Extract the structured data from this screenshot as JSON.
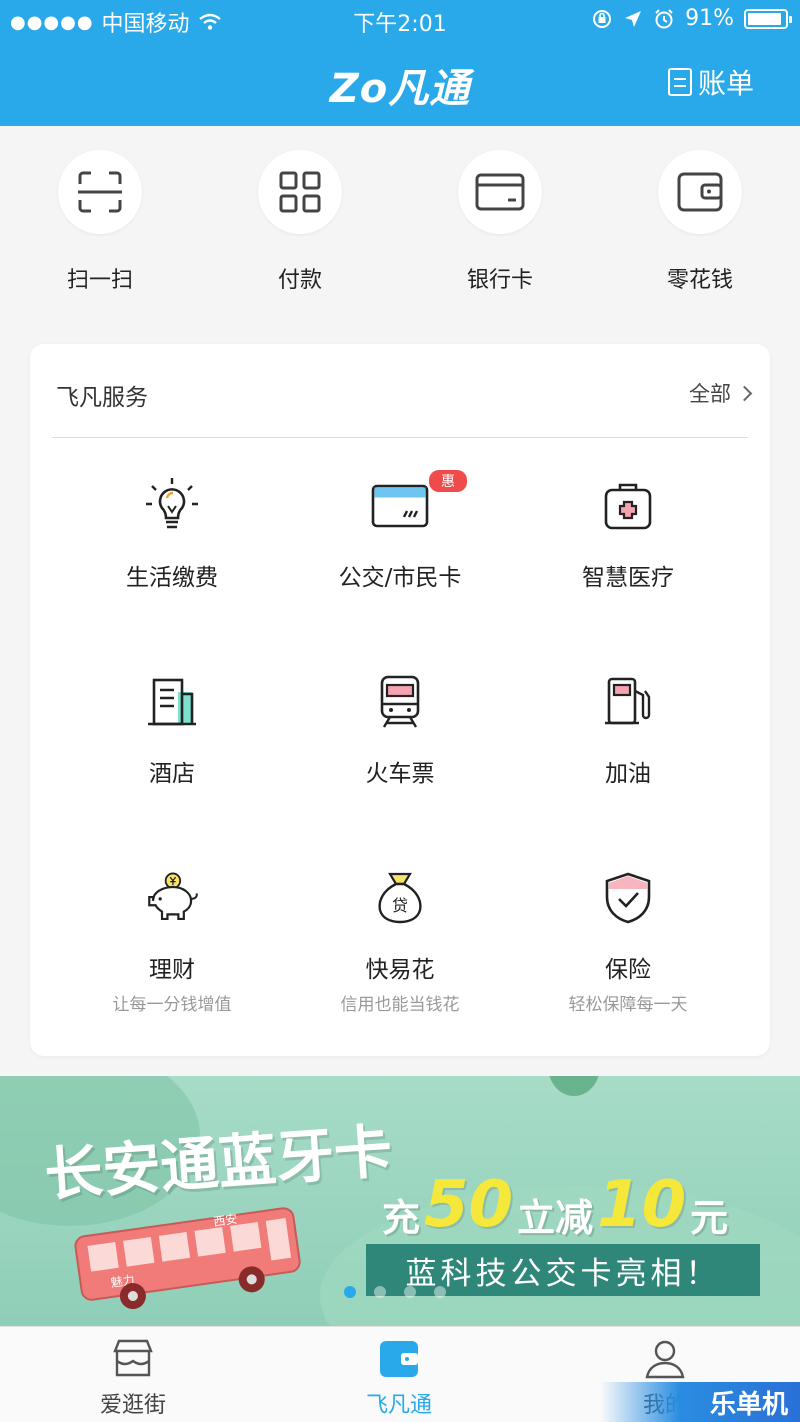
{
  "status_bar": {
    "signal": "●●●●●",
    "carrier": "中国移动",
    "time": "下午2:01",
    "battery_text": "91%",
    "battery_level": 0.91
  },
  "header": {
    "logo_text": "Zo凡通",
    "bill_label": "账单"
  },
  "quick_actions": [
    {
      "label": "扫一扫",
      "icon": "scan-icon"
    },
    {
      "label": "付款",
      "icon": "payment-code-icon"
    },
    {
      "label": "银行卡",
      "icon": "bank-card-icon"
    },
    {
      "label": "零花钱",
      "icon": "wallet-icon"
    }
  ],
  "services": {
    "title": "飞凡服务",
    "more_label": "全部",
    "items": [
      {
        "name": "生活缴费",
        "sub": "",
        "icon": "lightbulb-icon",
        "badge": ""
      },
      {
        "name": "公交/市民卡",
        "sub": "",
        "icon": "transit-card-icon",
        "badge": "惠"
      },
      {
        "name": "智慧医疗",
        "sub": "",
        "icon": "medical-kit-icon",
        "badge": ""
      },
      {
        "name": "酒店",
        "sub": "",
        "icon": "hotel-icon",
        "badge": ""
      },
      {
        "name": "火车票",
        "sub": "",
        "icon": "train-icon",
        "badge": ""
      },
      {
        "name": "加油",
        "sub": "",
        "icon": "fuel-pump-icon",
        "badge": ""
      },
      {
        "name": "理财",
        "sub": "让每一分钱增值",
        "icon": "piggy-bank-icon",
        "badge": ""
      },
      {
        "name": "快易花",
        "sub": "信用也能当钱花",
        "icon": "loan-bag-icon",
        "badge": ""
      },
      {
        "name": "保险",
        "sub": "轻松保障每一天",
        "icon": "shield-check-icon",
        "badge": ""
      }
    ]
  },
  "banner": {
    "title": "长安通蓝牙卡",
    "line2_a": "充",
    "line2_n1": "50",
    "line2_b": "立减",
    "line2_n2": "10",
    "line2_c": "元",
    "tagline": "蓝科技公交卡亮相！",
    "bus_sign": "西安",
    "bus_side": "魅力",
    "pages": 4,
    "active_page": 0
  },
  "tabbar": [
    {
      "label": "爱逛街",
      "icon": "shop-icon",
      "active": false
    },
    {
      "label": "飞凡通",
      "icon": "wallet-tab-icon",
      "active": true
    },
    {
      "label": "我的",
      "icon": "user-icon",
      "active": false
    }
  ],
  "watermark": "乐单机",
  "colors": {
    "brand": "#2aa9ea",
    "badge": "#f04b4b",
    "banner_green": "#8fceb8",
    "tag_bg": "#2f8779"
  }
}
